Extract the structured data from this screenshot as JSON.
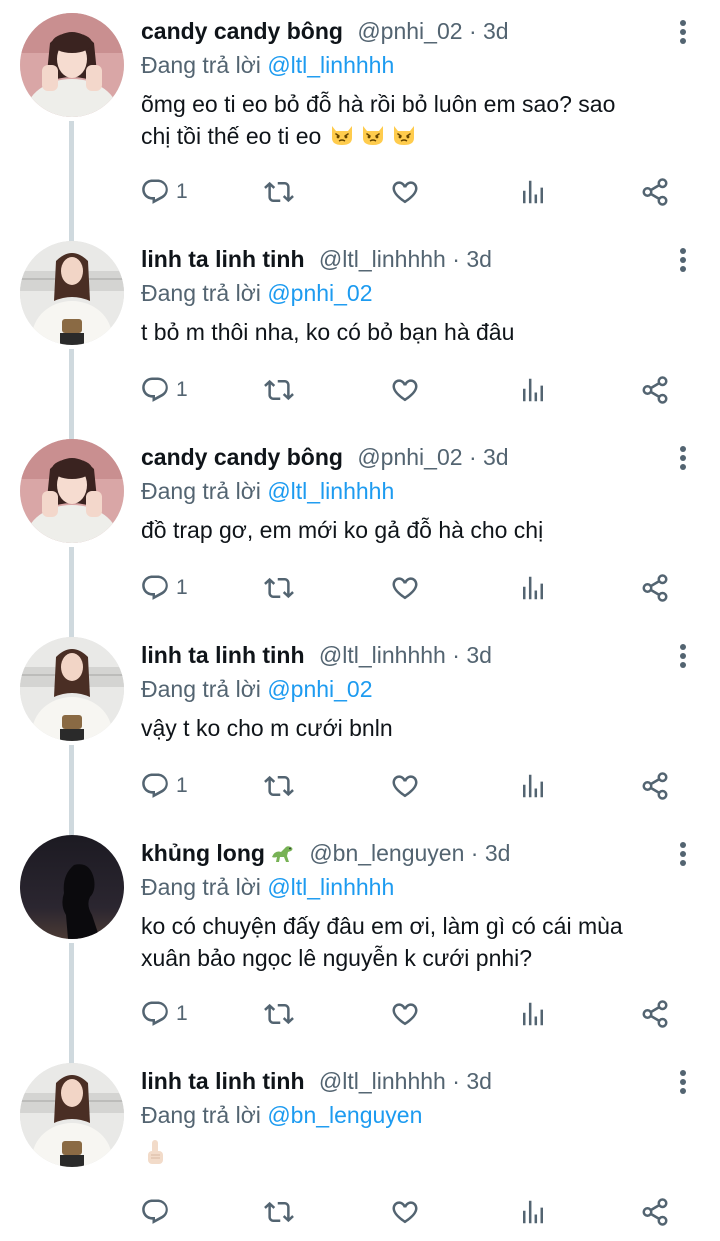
{
  "tweets": [
    {
      "name": "candy candy bông",
      "handle": "@pnhi_02",
      "time": "3d",
      "reply_prefix": "Đang trả lời",
      "reply_to": "@ltl_linhhhh",
      "text_lines": [
        "õmg eo ti eo bỏ đỗ hà rồi bỏ luôn em sao? sao",
        "chị tồi thế eo ti eo"
      ],
      "reply_count": "1",
      "avatar": "girl-pink-bg",
      "emoji_after_text": [
        "pouting-cat-emoji",
        "pouting-cat-emoji",
        "pouting-cat-emoji"
      ]
    },
    {
      "name": "linh ta linh tinh",
      "handle": "@ltl_linhhhh",
      "time": "3d",
      "reply_prefix": "Đang trả lời",
      "reply_to": "@pnhi_02",
      "text_lines": [
        "t bỏ m thôi nha, ko có bỏ bạn hà đâu"
      ],
      "reply_count": "1",
      "avatar": "girl-white-sweater"
    },
    {
      "name": "candy candy bông",
      "handle": "@pnhi_02",
      "time": "3d",
      "reply_prefix": "Đang trả lời",
      "reply_to": "@ltl_linhhhh",
      "text_lines": [
        "đồ trap gơ, em mới ko gả đỗ hà cho chị"
      ],
      "reply_count": "1",
      "avatar": "girl-pink-bg"
    },
    {
      "name": "linh ta linh tinh",
      "handle": "@ltl_linhhhh",
      "time": "3d",
      "reply_prefix": "Đang trả lời",
      "reply_to": "@pnhi_02",
      "text_lines": [
        "vậy t ko cho m cưới bnln"
      ],
      "reply_count": "1",
      "avatar": "girl-white-sweater"
    },
    {
      "name": "khủng long",
      "name_emoji": "dinosaur-emoji",
      "handle": "@bn_lenguyen",
      "time": "3d",
      "reply_prefix": "Đang trả lời",
      "reply_to": "@ltl_linhhhh",
      "text_lines": [
        "ko có chuyện đấy đâu em ơi, làm gì có cái mùa",
        "xuân bảo ngọc lê nguyễn k cưới pnhi?"
      ],
      "reply_count": "1",
      "avatar": "dark-silhouette"
    },
    {
      "name": "linh ta linh tinh",
      "handle": "@ltl_linhhhh",
      "time": "3d",
      "reply_prefix": "Đang trả lời",
      "reply_to": "@bn_lenguyen",
      "text_lines": [],
      "reply_count": "",
      "avatar": "girl-white-sweater",
      "reaction_emoji": "pointing-up-emoji"
    }
  ],
  "colors": {
    "name": "#0f1419",
    "secondary": "#536471",
    "mention": "#1d9bf0",
    "thread_line": "#cfd9de"
  },
  "icons": [
    "reply-icon",
    "retweet-icon",
    "like-icon",
    "analytics-icon",
    "share-icon",
    "more-icon"
  ]
}
